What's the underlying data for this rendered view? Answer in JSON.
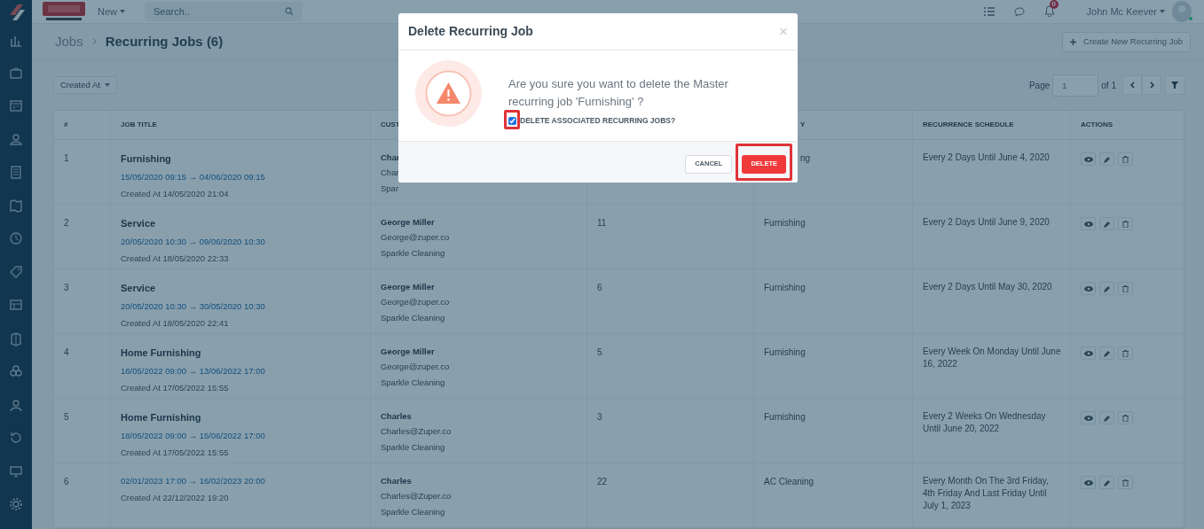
{
  "topbar": {
    "new_menu": "New",
    "search": {
      "placeholder": "Search.."
    },
    "notification_badge": "0",
    "user_name": "John Mc Keever",
    "user_online": true
  },
  "breadcrumb": {
    "parent": "Jobs",
    "current": "Recurring Jobs (6)"
  },
  "create_button": "Create New Recurring Job",
  "sort_button": "Created At",
  "pagination": {
    "label": "Page",
    "value": "1",
    "total": "of 1"
  },
  "table": {
    "columns": [
      {
        "label": "#"
      },
      {
        "label": "JOB TITLE"
      },
      {
        "label": "CUST"
      },
      {},
      {
        "label": "Y",
        "clipped_left": true
      },
      {
        "label": "RECURRENCE SCHEDULE"
      },
      {
        "label": "ACTIONS"
      }
    ],
    "rows": [
      {
        "number": "1",
        "title": "Furnishing",
        "dates": "15/05/2020 09:15 → 04/06/2020 09:15",
        "created": "Created At 14/05/2020 21:04",
        "customer": {
          "name": "Char",
          "email": "Char",
          "company": "Spar"
        },
        "category": "ng",
        "category_clipped_left": true,
        "schedule": "Every 2 Days Until June 4, 2020"
      },
      {
        "number": "2",
        "title": "Service",
        "dates": "20/05/2020 10:30 → 09/06/2020 10:30",
        "created": "Created At 18/05/2020 22:33",
        "customer": {
          "name": "George Miller",
          "email": "George@zuper.co",
          "company": "Sparkle Cleaning"
        },
        "column_4": "11",
        "category": "Furnishing",
        "schedule": "Every 2 Days Until June 9, 2020"
      },
      {
        "number": "3",
        "title": "Service",
        "dates": "20/05/2020 10:30 → 30/05/2020 10:30",
        "created": "Created At 18/05/2020 22:41",
        "customer": {
          "name": "George Miller",
          "email": "George@zuper.co",
          "company": "Sparkle Cleaning"
        },
        "column_4": "6",
        "category": "Furnishing",
        "schedule": "Every 2 Days Until May 30, 2020"
      },
      {
        "number": "4",
        "title": "Home Furnishing",
        "dates": "16/05/2022 09:00 → 13/06/2022 17:00",
        "created": "Created At 17/05/2022 15:55",
        "customer": {
          "name": "George Miller",
          "email": "George@zuper.co",
          "company": "Sparkle Cleaning"
        },
        "column_4": "5",
        "category": "Furnishing",
        "schedule": "Every Week On Monday Until June 16, 2022"
      },
      {
        "number": "5",
        "title": "Home Furnishing",
        "dates": "18/05/2022 09:00 → 15/06/2022 17:00",
        "created": "Created At 17/05/2022 15:55",
        "customer": {
          "name": "Charles",
          "email": "Charles@Zuper.co",
          "company": "Sparkle Cleaning"
        },
        "column_4": "3",
        "category": "Furnishing",
        "schedule": "Every 2 Weeks On Wednesday Until June 20, 2022"
      },
      {
        "number": "6",
        "dates": "02/01/2023 17:00 → 16/02/2023 20:00",
        "created": "Created At 22/12/2022 19:20",
        "customer": {
          "name": "Charles",
          "email": "Charles@Zuper.co",
          "company": "Sparkle Cleaning"
        },
        "column_4": "22",
        "category": "AC Cleaning",
        "schedule": "Every Month On The 3rd Friday, 4th Friday And Last Friday Until July 1, 2023"
      }
    ]
  },
  "dialog": {
    "title": "Delete Recurring Job",
    "close": "×",
    "message": "Are you sure you want to delete the Master recurring job 'Furnishing' ?",
    "checkbox": {
      "label": "DELETE ASSOCIATED RECURRING JOBS?",
      "checked": true,
      "highlighted": true
    },
    "buttons": [
      {
        "label": "CANCEL",
        "kind": "secondary",
        "highlighted": false
      },
      {
        "label": "DELETE",
        "kind": "danger",
        "highlighted": true
      }
    ]
  }
}
